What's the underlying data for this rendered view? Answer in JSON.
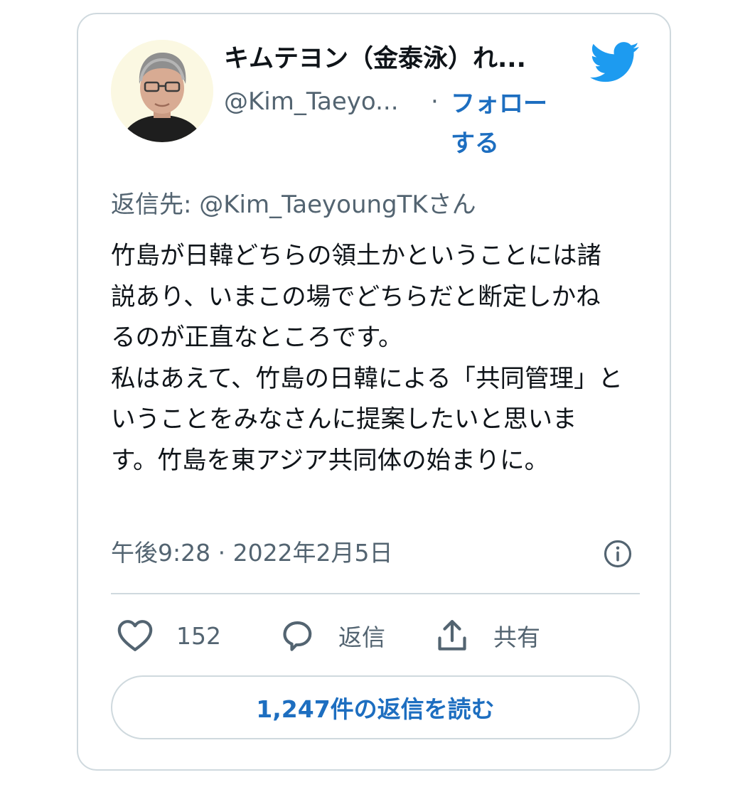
{
  "author": {
    "display_name": "キムテヨン（金泰泳）れ...",
    "handle": "@Kim_Taeyo...",
    "separator": "·",
    "follow_label": "フォローする",
    "avatar_icon": "profile-photo"
  },
  "brand": {
    "logo_icon": "twitter-bird-icon",
    "color": "#1d9bf0"
  },
  "reply_to": {
    "prefix": "返信先: @Kim_TaeyoungTKさん"
  },
  "tweet": {
    "text": "竹島が日韓どちらの領土かということには諸説あり、いまこの場でどちらだと断定しかねるのが正直なところです。\n私はあえて、竹島の日韓による「共同管理」ということをみなさんに提案したいと思います。竹島を東アジア共同体の始まりに。",
    "timestamp": "午後9:28 · 2022年2月5日"
  },
  "actions": {
    "like_count": "152",
    "reply_label": "返信",
    "share_label": "共有"
  },
  "read_replies_label": "1,247件の返信を読む",
  "colors": {
    "link": "#1d6ec0",
    "muted": "#536471",
    "border": "#cfd9de"
  }
}
